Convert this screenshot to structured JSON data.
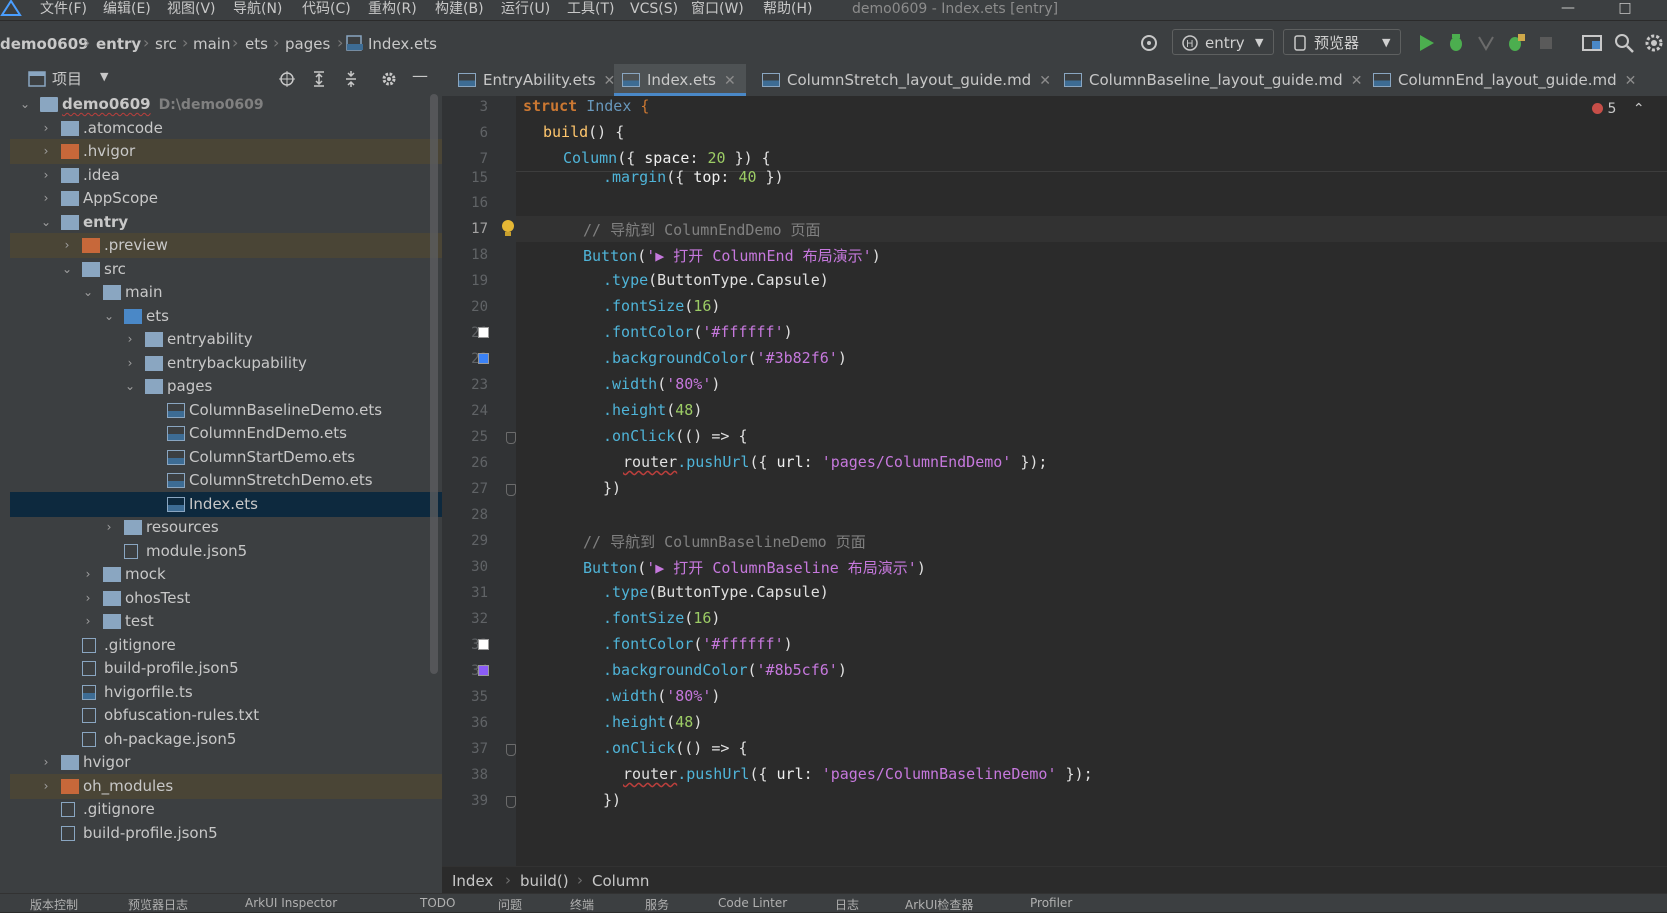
{
  "menu": [
    "文件(F)",
    "编辑(E)",
    "视图(V)",
    "导航(N)",
    "代码(C)",
    "重构(R)",
    "构建(B)",
    "运行(U)",
    "工具(T)",
    "VCS(S)",
    "窗口(W)",
    "帮助(H)"
  ],
  "window_title": "demo0609 - Index.ets [entry]",
  "breadcrumbs": [
    "demo0609",
    "entry",
    "src",
    "main",
    "ets",
    "pages",
    "Index.ets"
  ],
  "run_config": "entry",
  "previewer_label": "预览器",
  "project_panel_title": "项目",
  "tree": [
    {
      "label": "demo0609",
      "path": "D:\\demo0609"
    },
    {
      "label": ".atomcode"
    },
    {
      "label": ".hvigor"
    },
    {
      "label": ".idea"
    },
    {
      "label": "AppScope"
    },
    {
      "label": "entry"
    },
    {
      "label": ".preview"
    },
    {
      "label": "src"
    },
    {
      "label": "main"
    },
    {
      "label": "ets"
    },
    {
      "label": "entryability"
    },
    {
      "label": "entrybackupability"
    },
    {
      "label": "pages"
    },
    {
      "label": "ColumnBaselineDemo.ets"
    },
    {
      "label": "ColumnEndDemo.ets"
    },
    {
      "label": "ColumnStartDemo.ets"
    },
    {
      "label": "ColumnStretchDemo.ets"
    },
    {
      "label": "Index.ets"
    },
    {
      "label": "resources"
    },
    {
      "label": "module.json5"
    },
    {
      "label": "mock"
    },
    {
      "label": "ohosTest"
    },
    {
      "label": "test"
    },
    {
      "label": ".gitignore"
    },
    {
      "label": "build-profile.json5"
    },
    {
      "label": "hvigorfile.ts"
    },
    {
      "label": "obfuscation-rules.txt"
    },
    {
      "label": "oh-package.json5"
    },
    {
      "label": "hvigor"
    },
    {
      "label": "oh_modules"
    },
    {
      "label": ".gitignore"
    },
    {
      "label": "build-profile.json5"
    }
  ],
  "tabs": [
    "EntryAbility.ets",
    "Index.ets",
    "ColumnStretch_layout_guide.md",
    "ColumnBaseline_layout_guide.md",
    "ColumnEnd_layout_guide.md"
  ],
  "error_count": "5",
  "line_numbers": [
    "3",
    "6",
    "7",
    "15",
    "16",
    "17",
    "18",
    "19",
    "20",
    "21",
    "22",
    "23",
    "24",
    "25",
    "26",
    "27",
    "28",
    "29",
    "30",
    "31",
    "32",
    "33",
    "34",
    "35",
    "36",
    "37",
    "38",
    "39"
  ],
  "code": {
    "l3_a": "struct",
    "l3_b": "Index",
    "l3_c": "{",
    "l6_a": "build",
    "l6_b": "() {",
    "l7_a": "Column",
    "l7_b": "({ ",
    "l7_c": "space",
    "l7_d": ": ",
    "l7_e": "20",
    "l7_f": " }) {",
    "l15_a": ".margin",
    "l15_b": "({ ",
    "l15_c": "top",
    "l15_d": ": ",
    "l15_e": "40",
    "l15_f": " })",
    "l17": "// 导航到 ColumnEndDemo 页面",
    "l18_a": "Button",
    "l18_b": "(",
    "l18_c": "'▶ 打开 ColumnEnd 布局演示'",
    "l18_d": ")",
    "l19_a": ".type",
    "l19_b": "(ButtonType.Capsule)",
    "l20_a": ".fontSize",
    "l20_b": "(",
    "l20_c": "16",
    "l20_d": ")",
    "l21_a": ".fontColor",
    "l21_b": "(",
    "l21_c": "'#ffffff'",
    "l21_d": ")",
    "l22_a": ".backgroundColor",
    "l22_b": "(",
    "l22_c": "'#3b82f6'",
    "l22_d": ")",
    "l23_a": ".width",
    "l23_b": "(",
    "l23_c": "'80%'",
    "l23_d": ")",
    "l24_a": ".height",
    "l24_b": "(",
    "l24_c": "48",
    "l24_d": ")",
    "l25_a": ".onClick",
    "l25_b": "(() => {",
    "l26_a": "router",
    "l26_b": ".pushUrl",
    "l26_c": "({ ",
    "l26_d": "url",
    "l26_e": ": ",
    "l26_f": "'pages/ColumnEndDemo'",
    "l26_g": " });",
    "l27": "})",
    "l29": "// 导航到 ColumnBaselineDemo 页面",
    "l30_a": "Button",
    "l30_b": "(",
    "l30_c": "'▶ 打开 ColumnBaseline 布局演示'",
    "l30_d": ")",
    "l31_a": ".type",
    "l31_b": "(ButtonType.Capsule)",
    "l32_a": ".fontSize",
    "l32_b": "(",
    "l32_c": "16",
    "l32_d": ")",
    "l33_a": ".fontColor",
    "l33_b": "(",
    "l33_c": "'#ffffff'",
    "l33_d": ")",
    "l34_a": ".backgroundColor",
    "l34_b": "(",
    "l34_c": "'#8b5cf6'",
    "l34_d": ")",
    "l35_a": ".width",
    "l35_b": "(",
    "l35_c": "'80%'",
    "l35_d": ")",
    "l36_a": ".height",
    "l36_b": "(",
    "l36_c": "48",
    "l36_d": ")",
    "l37_a": ".onClick",
    "l37_b": "(() => {",
    "l38_a": "router",
    "l38_b": ".pushUrl",
    "l38_c": "({ ",
    "l38_d": "url",
    "l38_e": ": ",
    "l38_f": "'pages/ColumnBaselineDemo'",
    "l38_g": " });",
    "l39": "})"
  },
  "swatch_colors": {
    "white": "#ffffff",
    "blue": "#3b82f6",
    "purple": "#8b5cf6"
  },
  "editor_breadcrumbs": [
    "Index",
    "build()",
    "Column"
  ],
  "bottom_tools": [
    "版本控制",
    "预览器日志",
    "ArkUI Inspector",
    "TODO",
    "问题",
    "终端",
    "服务",
    "Code Linter",
    "日志",
    "ArkUI检查器",
    "Profiler"
  ]
}
